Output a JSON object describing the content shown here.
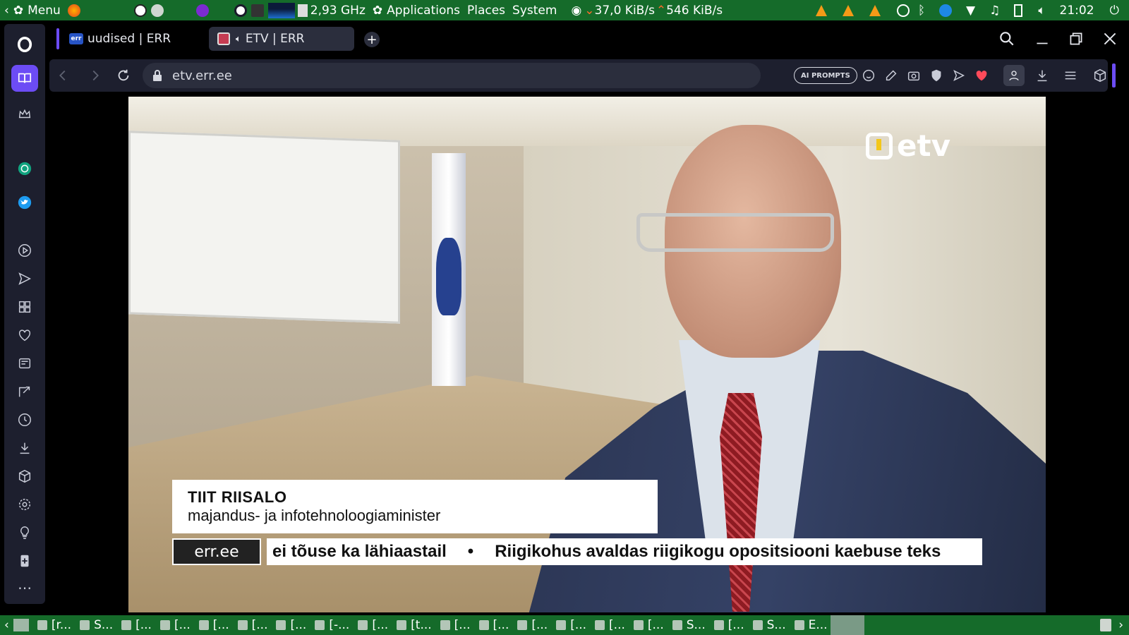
{
  "top_panel": {
    "menu_label": "Menu",
    "cpu_freq": "2,93 GHz",
    "applications_label": "Applications",
    "places_label": "Places",
    "system_label": "System",
    "net_down": "37,0 KiB/s",
    "net_up": "546 KiB/s",
    "clock": "21:02"
  },
  "tabs": [
    {
      "label": "uudised | ERR",
      "favicon_text": "err"
    },
    {
      "label": "ETV | ERR"
    }
  ],
  "address_bar": {
    "url": "etv.err.ee",
    "ai_prompts_label": "AI PROMPTS"
  },
  "video": {
    "channel_logo": "etv",
    "lower_third": {
      "name": "TIIT RIISALO",
      "role": "majandus- ja infotehnoloogiaminister"
    },
    "ticker_source": "err.ee",
    "ticker_items": [
      "ei tõuse ka lähiaastail",
      "Riigikohus avaldas riigikogu opositsiooni kaebuse teks"
    ],
    "ticker_separator": "•"
  },
  "taskbar": {
    "items": [
      "[r...",
      "S...",
      "[...",
      "[...",
      "[...",
      "[...",
      "[...",
      "[-...",
      "[...",
      "[t...",
      "[...",
      "[...",
      "[...",
      "[...",
      "[...",
      "[...",
      "S...",
      "[...",
      "S...",
      "E..."
    ]
  },
  "colors": {
    "panel_green": "#156b2a",
    "sidebar_bg": "#1d1f2e",
    "opera_accent": "#6c4cf5"
  }
}
